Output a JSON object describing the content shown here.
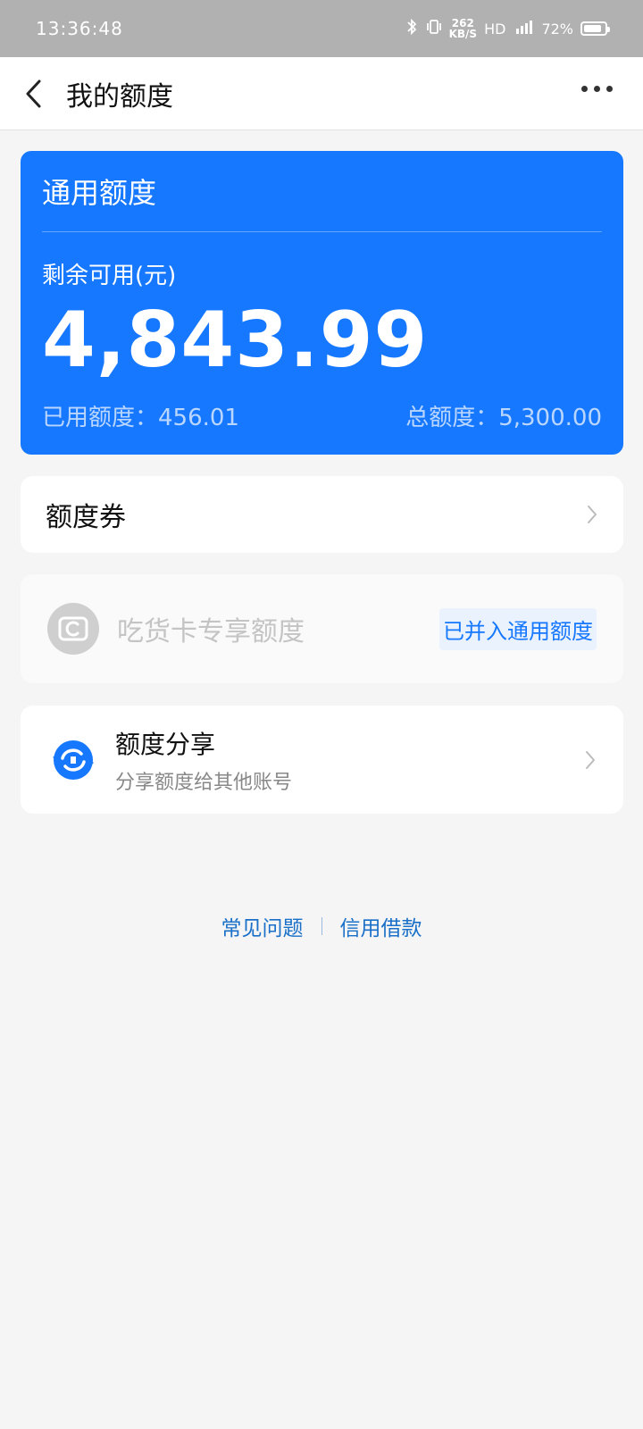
{
  "status": {
    "time": "13:36:48",
    "speed_top": "262",
    "speed_bottom": "KB/S",
    "hd": "HD",
    "battery": "72%"
  },
  "nav": {
    "title": "我的额度"
  },
  "quota_card": {
    "title": "通用额度",
    "remaining_label": "剩余可用(元)",
    "remaining_amount": "4,843.99",
    "used_text": "已用额度：456.01",
    "total_text": "总额度：5,300.00"
  },
  "coupon": {
    "label": "额度券"
  },
  "snack_card": {
    "label": "吃货卡专享额度",
    "badge": "已并入通用额度"
  },
  "share": {
    "title": "额度分享",
    "subtitle": "分享额度给其他账号"
  },
  "footer": {
    "faq": "常见问题",
    "loan": "信用借款"
  },
  "colors": {
    "accent": "#1677ff",
    "link": "#1a70c8"
  }
}
